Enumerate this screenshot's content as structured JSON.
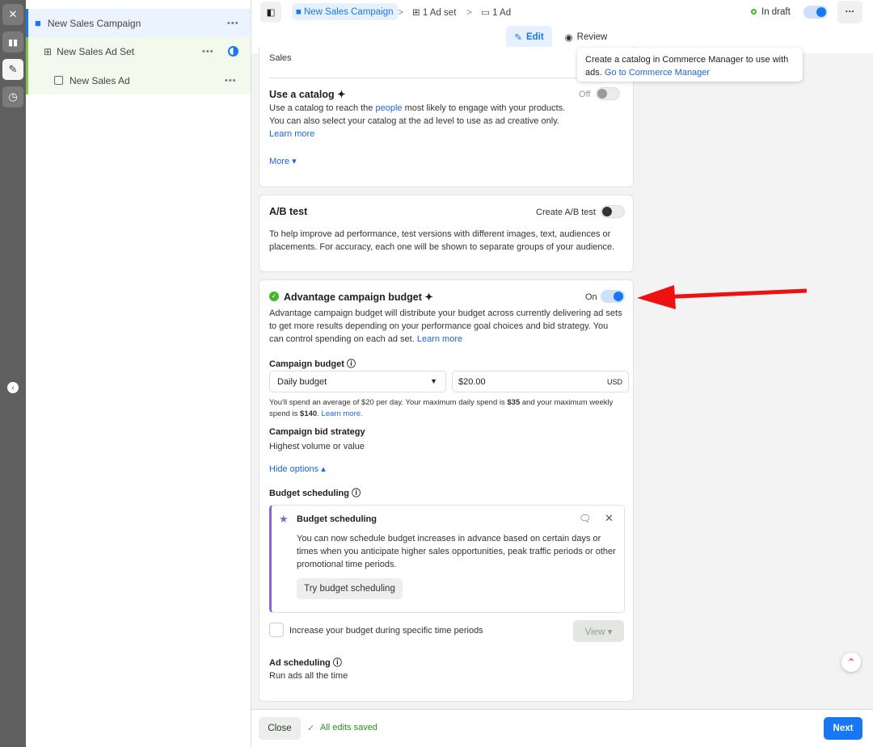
{
  "rail": {
    "icons": [
      "close-icon",
      "chart-icon",
      "pencil-icon",
      "clock-icon"
    ]
  },
  "tree": {
    "campaign": "New Sales Campaign",
    "adset": "New Sales Ad Set",
    "ad": "New Sales Ad",
    "more": "•••"
  },
  "breadcrumb": {
    "campaign": "New Sales Campaign",
    "adset": "1 Ad set",
    "ad": "1 Ad",
    "sep": ">"
  },
  "status": {
    "label": "In draft",
    "color": "#42b72a"
  },
  "modes": {
    "edit": "Edit",
    "review": "Review"
  },
  "tooltip": {
    "text": "Create a catalog in Commerce Manager to use with ads.",
    "link": "Go to Commerce Manager"
  },
  "catalog_card": {
    "objective": "Sales",
    "title": "Use a catalog",
    "toggle_label": "Off",
    "desc_pre": "Use a catalog to reach the ",
    "desc_link": "people",
    "desc_post": " most likely to engage with your products. You can also select your catalog at the ad level to use as ad creative only. ",
    "learn": "Learn more",
    "more": "More ▾"
  },
  "ab_card": {
    "title": "A/B test",
    "toggle_label": "Create A/B test",
    "desc": "To help improve ad performance, test versions with different images, text, audiences or placements. For accuracy, each one will be shown to separate groups of your audience."
  },
  "budget_card": {
    "title": "Advantage campaign budget",
    "toggle_label": "On",
    "desc": "Advantage campaign budget will distribute your budget across currently delivering ad sets to get more results depending on your performance goal choices and bid strategy. You can control spending on each ad set. ",
    "learn": "Learn more",
    "budget_label": "Campaign budget",
    "budget_type": "Daily budget",
    "amount": "$20.00",
    "currency": "USD",
    "spend_a": "You'll spend an average of $20 per day. Your maximum daily spend is ",
    "spend_b": "$35",
    "spend_c": " and your maximum weekly spend is ",
    "spend_d": "$140",
    "spend_e": ". ",
    "spend_learn": "Learn more.",
    "bid_label": "Campaign bid strategy",
    "bid_value": "Highest volume or value",
    "hide_options": "Hide options ▴",
    "sched_label": "Budget scheduling",
    "promo_title": "Budget scheduling",
    "promo_desc": "You can now schedule budget increases in advance based on certain days or times when you anticipate higher sales opportunities, peak traffic periods or other promotional time periods.",
    "promo_button": "Try budget scheduling",
    "checkbox_label": "Increase your budget during specific time periods",
    "view": "View ▾",
    "ad_sched_label": "Ad scheduling",
    "ad_sched_value": "Run ads all the time"
  },
  "footer": {
    "close": "Close",
    "saved": "All edits saved",
    "next": "Next"
  },
  "colors": {
    "accent": "#1877f2",
    "arrow": "#ee1111"
  }
}
